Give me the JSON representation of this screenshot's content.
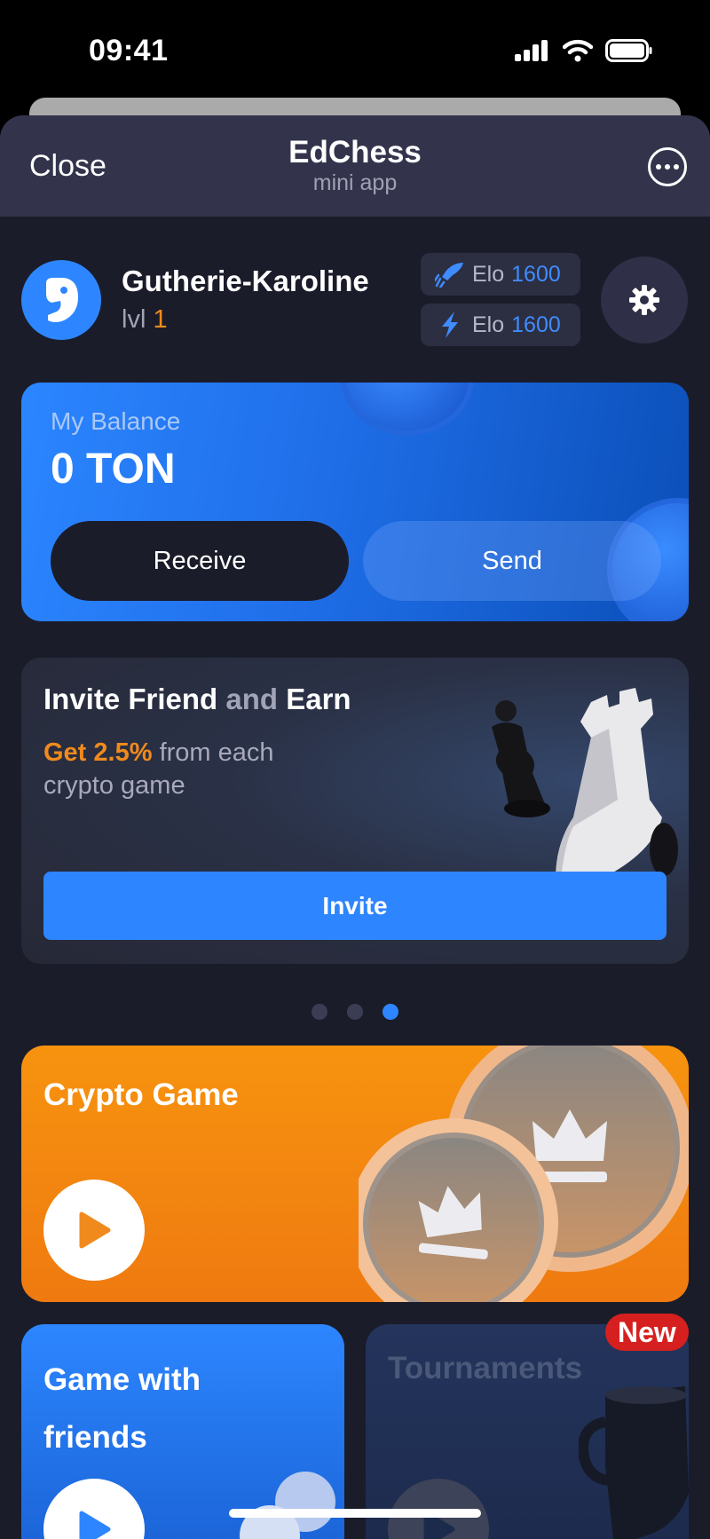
{
  "status_bar": {
    "time": "09:41",
    "icons": [
      "signal-icon",
      "wifi-icon",
      "battery-icon"
    ]
  },
  "header": {
    "close_label": "Close",
    "title": "EdChess",
    "subtitle": "mini app",
    "more_icon": "more-icon"
  },
  "profile": {
    "username": "Gutherie-Karoline",
    "level_label": "lvl",
    "level_value": "1",
    "elo": [
      {
        "icon": "rocket-icon",
        "label": "Elo",
        "value": "1600"
      },
      {
        "icon": "lightning-icon",
        "label": "Elo",
        "value": "1600"
      }
    ],
    "settings_icon": "gear-icon"
  },
  "balance": {
    "label": "My Balance",
    "value": "0 TON",
    "receive_label": "Receive",
    "send_label": "Send"
  },
  "invite": {
    "title_part1": "Invite Friend",
    "title_part2": "and",
    "title_part3": "Earn",
    "highlight": "Get 2.5%",
    "desc": "from each crypto game",
    "button_label": "Invite"
  },
  "carousel": {
    "count": 3,
    "active_index": 2
  },
  "crypto_game": {
    "title": "Crypto Game"
  },
  "friends_game": {
    "title": "Game with friends"
  },
  "tournaments": {
    "title": "Tournaments",
    "badge": "New"
  },
  "colors": {
    "accent_blue": "#2d86ff",
    "accent_orange": "#f08a1c",
    "background": "#1b1c2a",
    "badge_red": "#d5201f"
  }
}
